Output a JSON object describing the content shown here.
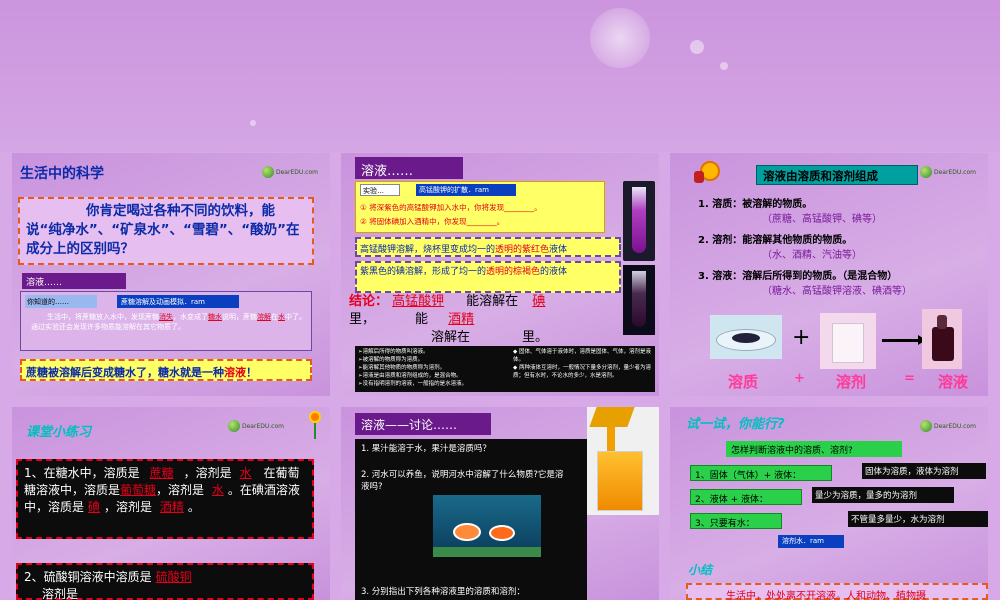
{
  "colors": {
    "bg": "#d7a9e6",
    "title_purple": "#7a1a9a",
    "red": "#e4001b",
    "yellow_box": "#ffff66",
    "dark_box": "#0c0c0c"
  },
  "logo_text": "DearEDU.com",
  "slide1": {
    "title": "生活中的科学",
    "question": "你肯定喝过各种不同的饮料，能说“纯净水”、“矿泉水”、“雪碧”、“酸奶”在成分上的区别吗？",
    "solution_label": "溶液……",
    "know_label": "你知道的……",
    "sim_label": "蔗糖溶解及动画模拟．ram",
    "body_a": "生活中，将蔗糖放入水中，发现蔗糖",
    "fill1": "消失",
    "body_b": "，水变成了",
    "fill2": "糖水",
    "body_c": "说明，蔗糖",
    "fill3": "溶解",
    "body_d": "在",
    "fill4": "水",
    "body_e": "中了。通过实验还会发现许多物质能溶解在其它物质了。",
    "conclusion_a": "蔗糖被溶解后变成糖水了，糖水就是一种",
    "conclusion_red": "溶液",
    "conclusion_b": "！"
  },
  "slide2": {
    "title": "溶液……",
    "experiment_label": "实验…",
    "ram_label": "高锰酸钾的扩散．ram",
    "step1": "① 将深紫色的高锰酸钾加入水中，你将发现________。",
    "step2": "② 将固体碘加入酒精中，你发现________。",
    "result1_a": "高锰酸钾溶解，烧杯里变成均一的",
    "result1_b": "透明的",
    "result1_c": "紫红色",
    "result1_d": "液体",
    "result2_a": "紫黑色的碘溶解，形成了均一的",
    "result2_b": "透明的",
    "result2_c": "棕褐色",
    "result2_d": "的液体",
    "concl_label": "结论：",
    "concl_fill1": "高锰酸钾",
    "concl_can1": "能溶解在",
    "concl_fill2": "碘",
    "concl_li": "里，",
    "concl_can2": "能",
    "concl_fill3": "酒精",
    "concl_dissolve": "溶解在",
    "concl_li2": "里。",
    "black_left": [
      "➢溶解后所得的物质叫溶液。",
      "➢被溶解的物质称为溶质。",
      "➢能溶解其他物质的物质称为溶剂。",
      "➢溶液是由溶质和溶剂组成的，是混合物。",
      "➢没有指明溶剂的溶液，一般指的是水溶液。"
    ],
    "black_right": [
      "◆ 固体、气体溶于液体时，溶质是固体、气体，溶剂是液体。",
      "◆ 两种液体互溶时，一般情况下量多分溶剂，量少者为溶质；但有水时，不论水的多少，水是溶剂。"
    ]
  },
  "slide3": {
    "title": "溶液由溶质和溶剂组成",
    "item1": "1. 溶质：被溶解的物质。",
    "item1_ex": "（蔗糖、高锰酸钾、碘等）",
    "item2": "2. 溶剂：能溶解其他物质的物质。",
    "item2_ex": "（水、酒精、汽油等）",
    "item3": "3. 溶液：溶解后所得到的物质。（是混合物）",
    "item3_ex": "（糖水、高锰酸钾溶液、碘酒等）",
    "plus": "+",
    "eq_solute": "溶质",
    "eq_plus": "+",
    "eq_solvent": "溶剂",
    "eq_equals": "=",
    "eq_solution": "溶液"
  },
  "slide4": {
    "title": "课堂小练习",
    "q1_a": "1、在糖水中，溶质是",
    "q1_f1": "蔗糖",
    "q1_b": "，溶剂是",
    "q1_f2": "水",
    "q1_c": "在葡萄糖溶液中，溶质是",
    "q1_f3": "葡萄糖",
    "q1_d": "，溶剂是",
    "q1_f4": "水",
    "q1_e": "。在碘酒溶液中，溶质是",
    "q1_f5": "碘",
    "q1_f": "，溶剂是",
    "q1_f6": "酒精",
    "q1_g": "。",
    "q2_a": "2、硫酸铜溶液中溶质是",
    "q2_f1": "硫酸铜",
    "q2_b": "溶剂是"
  },
  "slide5": {
    "title": "溶液——讨论……",
    "q1": "1. 果汁能溶于水，果汁是溶质吗？",
    "q2": "2. 河水可以养鱼，说明河水中溶解了什么物质?它是溶液吗?",
    "q3": "3. 分别指出下列各种溶液里的溶质和溶剂："
  },
  "slide6": {
    "title": "试一试，你能行?",
    "question": "怎样判断溶液中的溶质、溶剂?",
    "r1_left": "1、固体（气体）+ 液体：",
    "r1_right": "固体为溶质，液体为溶剂",
    "r2_left": "2、液体 + 液体：",
    "r2_right": "量少为溶质，量多的为溶剂",
    "r3_left": "3、只要有水：",
    "r3_right": "不管量多量少，水为溶剂",
    "ram": "溶剂水．ram",
    "summary_title": "小结",
    "summary_text": "生活中，处处离不开溶液。人和动物、植物摄"
  }
}
